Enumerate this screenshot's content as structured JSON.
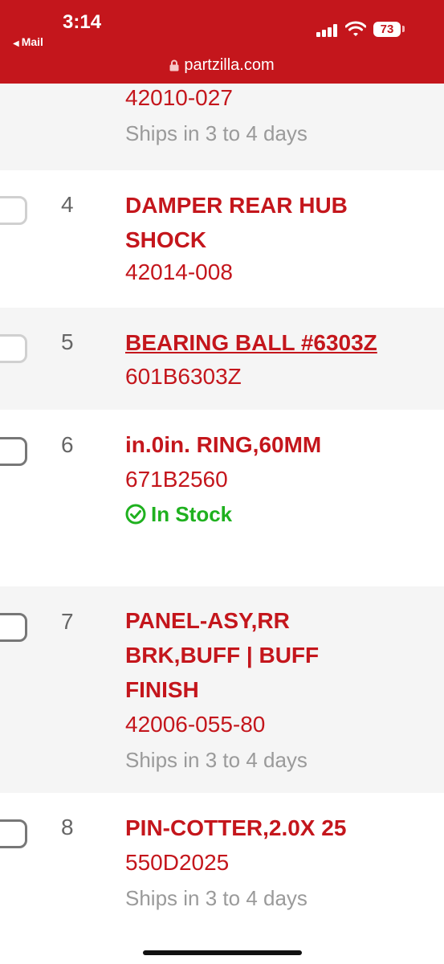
{
  "status_bar": {
    "time": "3:14",
    "back_app": "Mail",
    "battery": "73"
  },
  "browser": {
    "url": "partzilla.com"
  },
  "parts": [
    {
      "part_number": "42010-027",
      "availability": "Ships in 3 to 4 days"
    },
    {
      "index": "4",
      "name": "DAMPER REAR HUB SHOCK",
      "part_number": "42014-008"
    },
    {
      "index": "5",
      "name": "BEARING BALL #6303Z",
      "part_number": "601B6303Z"
    },
    {
      "index": "6",
      "name": "in.0in. RING,60MM",
      "part_number": "671B2560",
      "availability": "In Stock"
    },
    {
      "index": "7",
      "name": "PANEL-ASY,RR BRK,BUFF | BUFF FINISH",
      "part_number": "42006-055-80",
      "availability": "Ships in 3 to 4 days"
    },
    {
      "index": "8",
      "name": "PIN-COTTER,2.0X 25",
      "part_number": "550D2025",
      "availability": "Ships in 3 to 4 days"
    }
  ],
  "colors": {
    "brand_red": "#c4161c",
    "in_stock_green": "#1fb11f",
    "muted_gray": "#9a9a9a"
  }
}
